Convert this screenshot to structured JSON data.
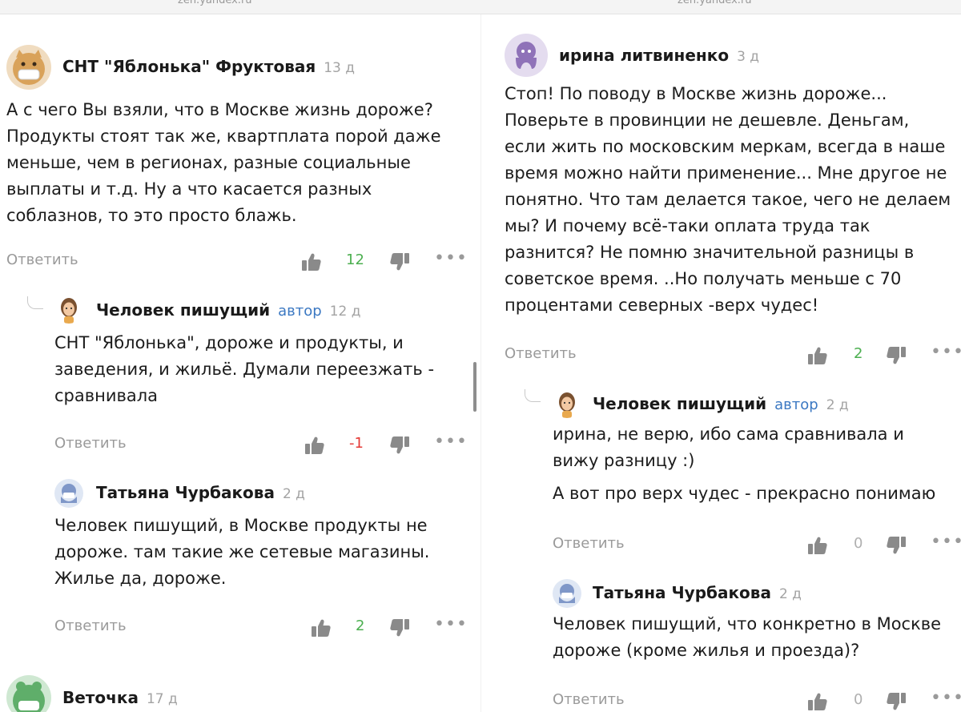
{
  "topbar": {
    "left_url": "zen.yandex.ru",
    "right_url": "zen.yandex.ru"
  },
  "labels": {
    "reply": "Ответить",
    "author": "автор",
    "more": "•••"
  },
  "colors": {
    "positive": "#4caf50",
    "negative": "#e53935",
    "author": "#3b78c2",
    "muted": "#9a9a9a"
  },
  "left": [
    {
      "name": "СНТ \"Яблонька\" Фруктовая",
      "age": "13 д",
      "lines": [
        "А с чего Вы взяли, что в Москве жизнь дороже?",
        "Продукты стоят так же, квартплата порой даже",
        "меньше, чем в регионах, разные социальные",
        "выплаты и т.д. Ну а что касается разных",
        "соблазнов, то это просто блажь."
      ],
      "votes": "12",
      "avatar": "cat-mask-avatar"
    },
    {
      "name": "Человек пишущий",
      "age": "12 д",
      "lines": [
        "СНТ \"Яблонька\", дороже и продукты, и",
        "заведения, и жильё. Думали переезжать -",
        "сравнивала"
      ],
      "votes": "-1",
      "avatar": "girl-avatar"
    },
    {
      "name": "Татьяна Чурбакова",
      "age": "2 д",
      "lines": [
        "Человек пишущий, в Москве продукты не",
        "дороже. там такие же сетевые магазины.",
        "Жилье да, дороже."
      ],
      "votes": "2",
      "avatar": "octopus-mask-avatar"
    },
    {
      "name": "Веточка",
      "age": "17 д",
      "avatar": "frog-mask-avatar"
    }
  ],
  "right": [
    {
      "name": "ирина литвиненко",
      "age": "3 д",
      "lines": [
        "Стоп! По поводу в Москве жизнь дороже...",
        "Поверьте в провинции не дешевле. Деньгам,",
        "если жить по московским меркам, всегда в наше",
        "время можно найти применение... Мне другое не",
        "понятно. Что там делается такое, чего не делаем",
        "мы? И почему всё-таки оплата труда так",
        "разнится? Не помню значительной разницы в",
        "советское время. ..Но получать меньше с 70",
        "процентами северных -верх чудес!"
      ],
      "votes": "2",
      "avatar": "octopus-avatar"
    },
    {
      "name": "Человек пишущий",
      "age": "2 д",
      "lines": [
        "ирина, не верю, ибо сама сравнивала и",
        "вижу разницу :)"
      ],
      "lines2": [
        "А вот про верх чудес - прекрасно понимаю"
      ],
      "votes": "0",
      "avatar": "girl-avatar"
    },
    {
      "name": "Татьяна Чурбакова",
      "age": "2 д",
      "lines": [
        "Человек пишущий, что конкретно в Москве",
        "дороже (кроме жилья и проезда)?"
      ],
      "votes": "0",
      "avatar": "octopus-mask-avatar"
    }
  ]
}
